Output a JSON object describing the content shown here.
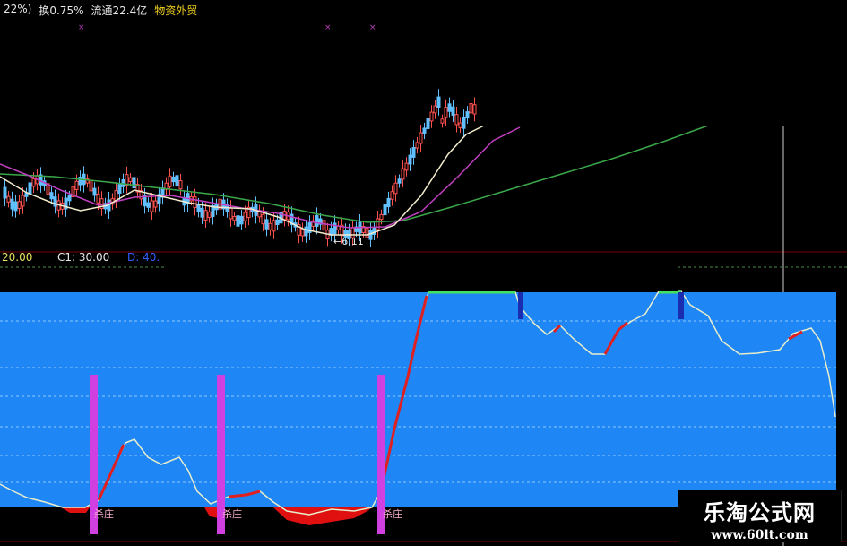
{
  "top_info": {
    "pct": "22%)",
    "turnover": "换0.75%",
    "float": "流通22.4亿",
    "sector": "物资外贸"
  },
  "indicator_bar": {
    "a_label": "20.00",
    "c1_label": "C1: 30.00",
    "d_label": "D: 40."
  },
  "price_marker": "←6.11",
  "signal_labels": [
    "杀庄",
    "杀庄",
    "杀庄"
  ],
  "watermark": {
    "title": "乐淘公式网",
    "url": "www.60lt.com"
  },
  "colors": {
    "background": "#000000",
    "blue_zone": "#1f86f5",
    "ma_white": "#f3eccc",
    "ma_purple": "#c040c0",
    "ma_green": "#3aa84a",
    "indicator_line": "#e8eecc",
    "indicator_up": "#e02020",
    "signal_bar": "#d040e0"
  }
}
